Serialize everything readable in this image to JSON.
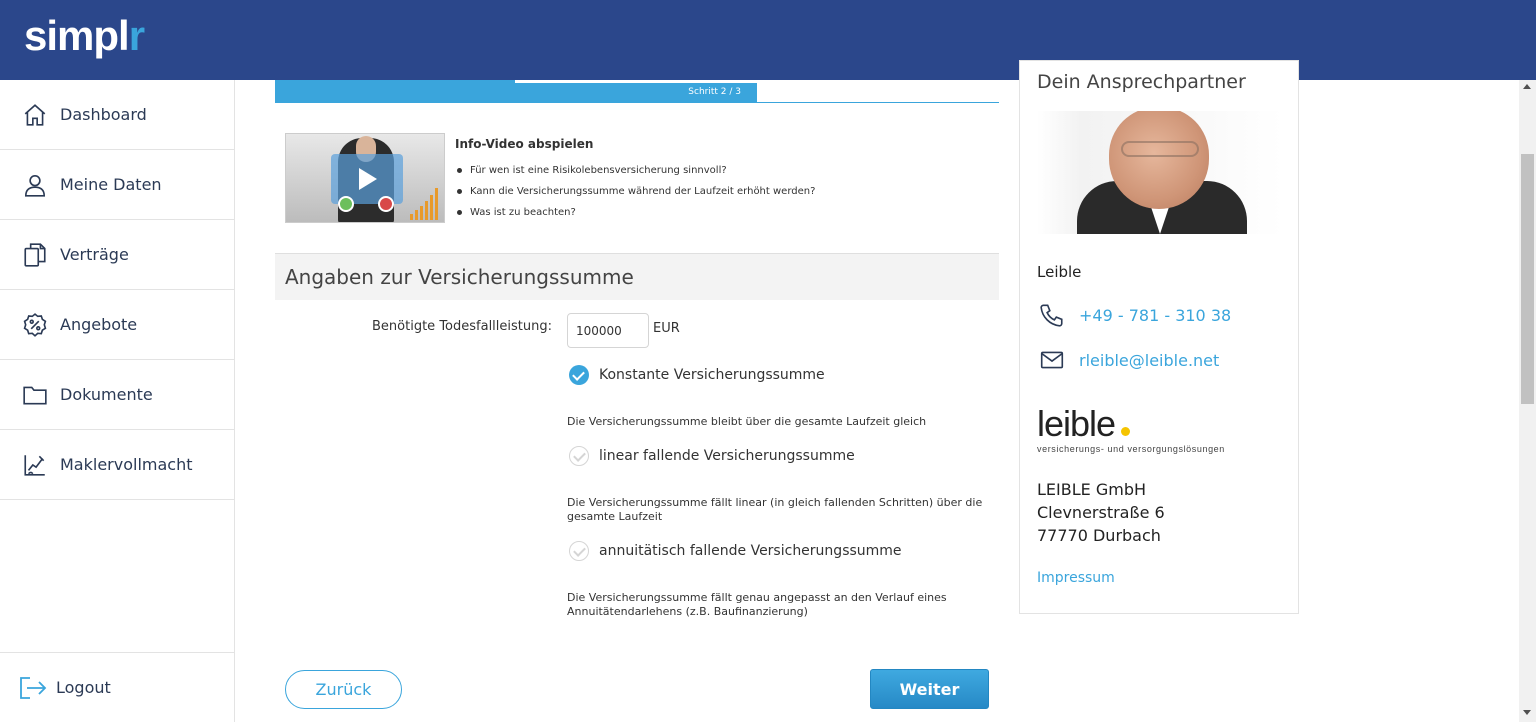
{
  "app": {
    "logo_main": "simpl",
    "logo_accent": "r"
  },
  "sidebar": {
    "items": [
      {
        "label": "Dashboard",
        "icon": "home-icon"
      },
      {
        "label": "Meine Daten",
        "icon": "user-icon"
      },
      {
        "label": "Verträge",
        "icon": "documents-icon"
      },
      {
        "label": "Angebote",
        "icon": "percent-badge-icon"
      },
      {
        "label": "Dokumente",
        "icon": "folder-icon"
      },
      {
        "label": "Maklervollmacht",
        "icon": "signature-chart-icon"
      }
    ],
    "logout_label": "Logout"
  },
  "progress": {
    "label": "Schritt 2 / 3",
    "current_step": 2,
    "total_steps": 3
  },
  "info_video": {
    "title": "Info-Video abspielen",
    "bullets": [
      "Für wen ist eine Risikolebensversicherung sinnvoll?",
      "Kann die Versicherungssumme während der Laufzeit erhöht werden?",
      "Was ist zu beachten?"
    ]
  },
  "form": {
    "section_title": "Angaben zur Versicherungssumme",
    "amount_label": "Benötigte Todesfallleistung:",
    "amount_value": "100000",
    "amount_unit": "EUR",
    "options": [
      {
        "label": "Konstante Versicherungssumme",
        "selected": true,
        "description": "Die Versicherungssumme bleibt über die gesamte Laufzeit gleich"
      },
      {
        "label": "linear fallende Versicherungssumme",
        "selected": false,
        "description": "Die Versicherungssumme fällt linear (in gleich fallenden Schritten) über die gesamte Laufzeit"
      },
      {
        "label": "annuitätisch fallende Versicherungssumme",
        "selected": false,
        "description": "Die Versicherungssumme fällt genau angepasst an den Verlauf eines Annuitätendarlehens (z.B. Baufinanzierung)"
      }
    ],
    "back_label": "Zurück",
    "next_label": "Weiter"
  },
  "contact": {
    "heading": "Dein Ansprechpartner",
    "name": "Leible",
    "phone": "+49 - 781 - 310 38",
    "email": "rleible@leible.net",
    "brand_word": "leible",
    "brand_tagline": "versicherungs- und versorgungslösungen",
    "company": "LEIBLE GmbH",
    "street": "Clevnerstraße 6",
    "city": "77770 Durbach",
    "impressum": "Impressum"
  },
  "colors": {
    "header": "#2b478b",
    "accent": "#3aa5dc",
    "button": "#2f96d3"
  }
}
